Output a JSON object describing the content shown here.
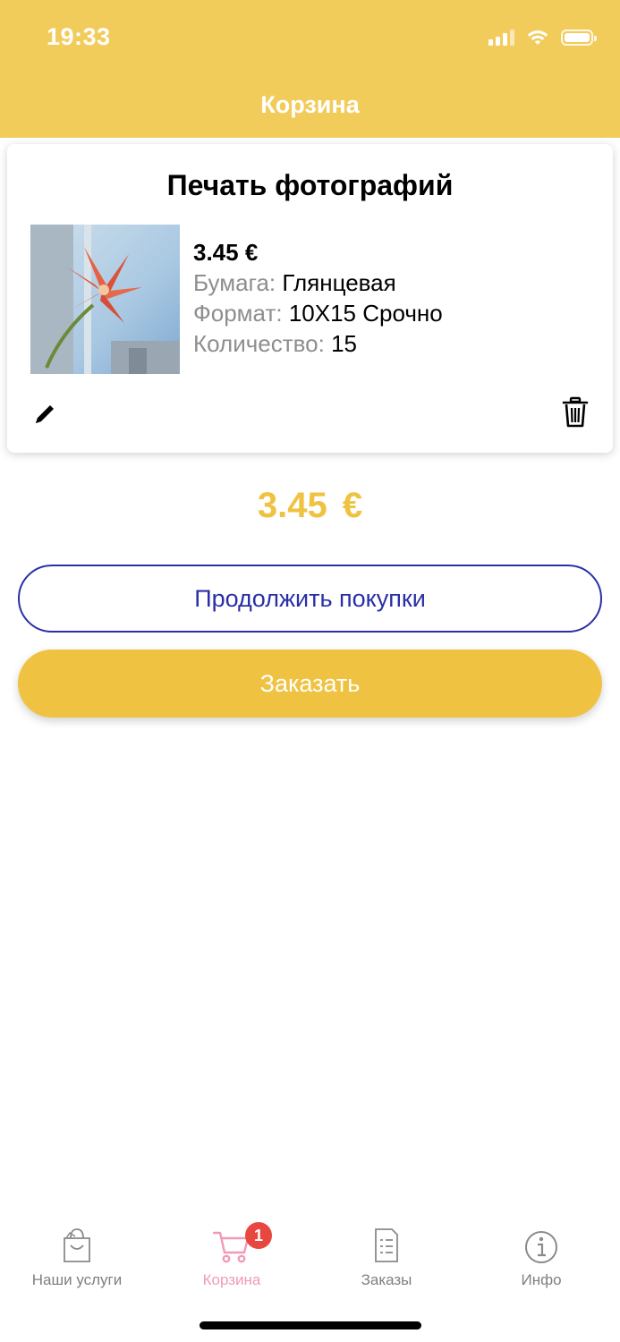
{
  "status_bar": {
    "time": "19:33"
  },
  "header": {
    "title": "Корзина",
    "background": "#F2CC5B"
  },
  "cart_item": {
    "title": "Печать фотографий",
    "price": "3.45 €",
    "details": [
      {
        "label": "Бумага:",
        "value": "Глянцевая"
      },
      {
        "label": "Формат:",
        "value": "10X15 Срочно"
      },
      {
        "label": "Количество:",
        "value": "15"
      }
    ],
    "thumbnail": "red-amaryllis-photo",
    "edit_icon": "pencil-icon",
    "delete_icon": "trash-icon"
  },
  "total": "3.45 €",
  "buttons": {
    "continue": "Продолжить покупки",
    "order": "Заказать"
  },
  "colors": {
    "accent_yellow": "#EFC241",
    "outline_blue": "#2A2FA8",
    "active_pink": "#F29AB5",
    "badge_red": "#E8473F"
  },
  "tabbar": {
    "items": [
      {
        "label": "Наши услуги",
        "icon": "shopping-bag-icon",
        "active": false
      },
      {
        "label": "Корзина",
        "icon": "cart-icon",
        "active": true,
        "badge": "1"
      },
      {
        "label": "Заказы",
        "icon": "document-list-icon",
        "active": false
      },
      {
        "label": "Инфо",
        "icon": "info-icon",
        "active": false
      }
    ]
  }
}
